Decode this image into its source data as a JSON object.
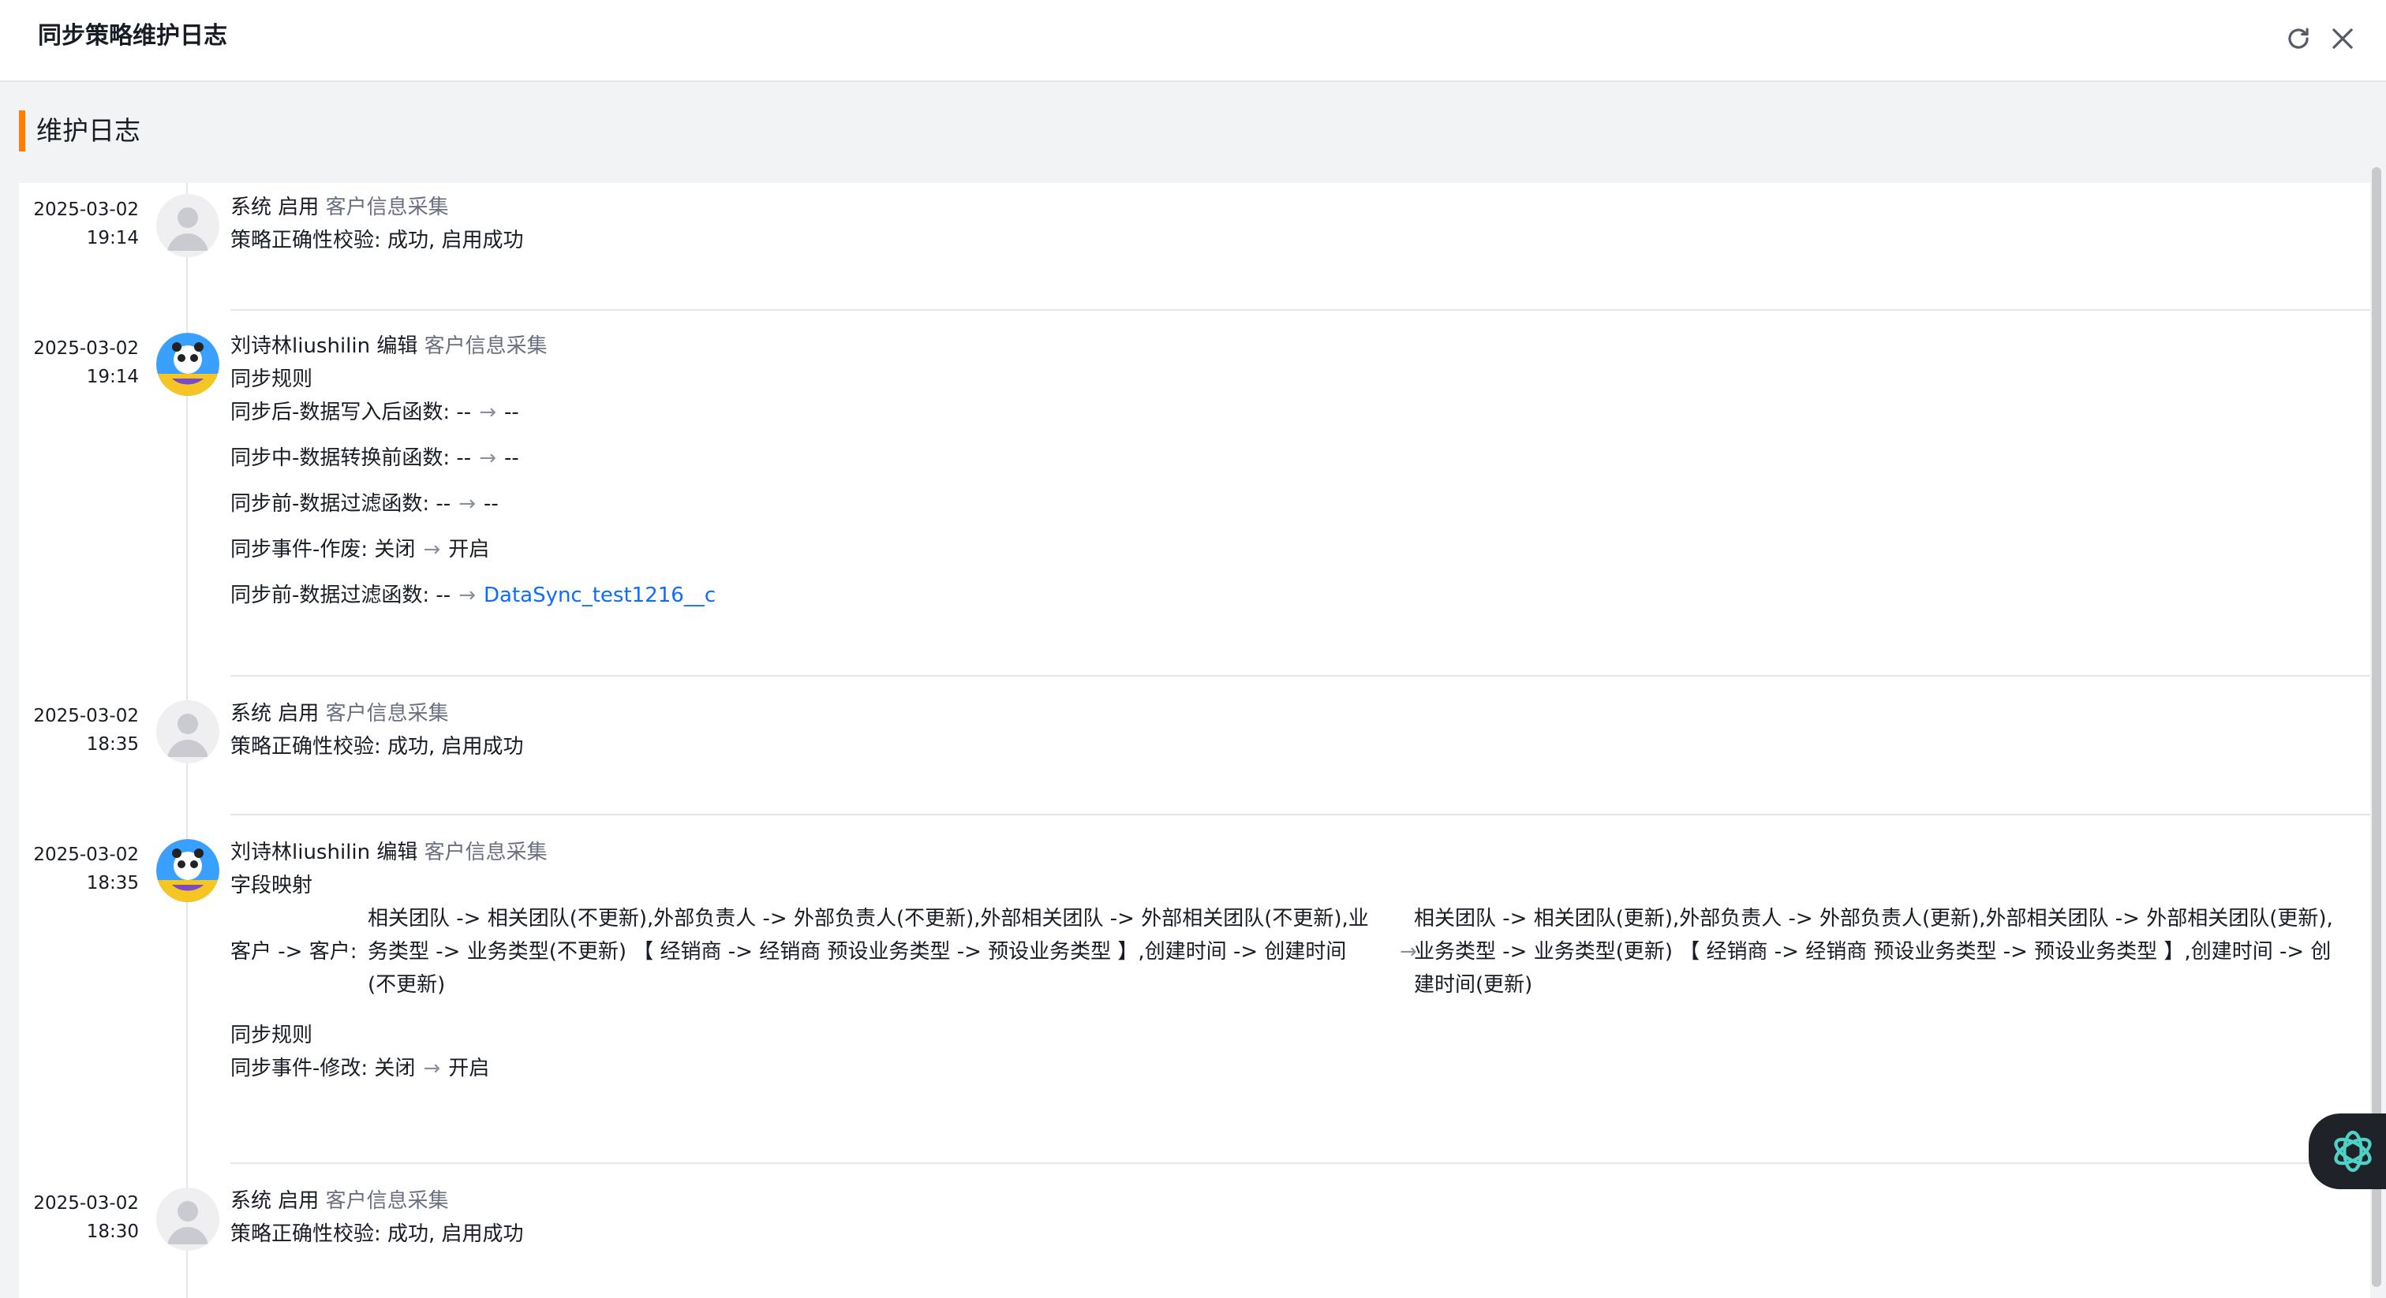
{
  "dialog": {
    "title": "同步策略维护日志",
    "refresh_icon": "refresh-icon",
    "close_icon": "close-icon"
  },
  "section": {
    "title": "维护日志"
  },
  "entries": [
    {
      "date": "2025-03-02",
      "time": "19:14",
      "actor": "系统",
      "action": "启用",
      "target": "客户信息采集",
      "lines": [
        "策略正确性校验: 成功, 启用成功"
      ]
    },
    {
      "date": "2025-03-02",
      "time": "19:14",
      "actor": "刘诗林liushilin",
      "action": "编辑",
      "target": "客户信息采集",
      "heading": "同步规则",
      "changes": [
        {
          "label": "同步后-数据写入后函数:",
          "from": "--",
          "to": "--"
        },
        {
          "label": "同步中-数据转换前函数:",
          "from": "--",
          "to": "--"
        },
        {
          "label": "同步前-数据过滤函数:",
          "from": "--",
          "to": "--"
        },
        {
          "label": "同步事件-作废:",
          "from": "关闭",
          "to": "开启"
        },
        {
          "label": "同步前-数据过滤函数:",
          "from": "--",
          "to": "DataSync_test1216__c"
        }
      ]
    },
    {
      "date": "2025-03-02",
      "time": "18:35",
      "actor": "系统",
      "action": "启用",
      "target": "客户信息采集",
      "lines": [
        "策略正确性校验: 成功, 启用成功"
      ]
    },
    {
      "date": "2025-03-02",
      "time": "18:35",
      "actor": "刘诗林liushilin",
      "action": "编辑",
      "target": "客户信息采集",
      "heading": "字段映射",
      "mapping": {
        "key": "客户 -> 客户:",
        "from": "相关团队 -> 相关团队(不更新),外部负责人 -> 外部负责人(不更新),外部相关团队 -> 外部相关团队(不更新),业务类型 -> 业务类型(不更新) 【 经销商 -> 经销商 预设业务类型 -> 预设业务类型 】,创建时间 -> 创建时间(不更新)",
        "to": "相关团队 -> 相关团队(更新),外部负责人 -> 外部负责人(更新),外部相关团队 -> 外部相关团队(更新),业务类型 -> 业务类型(更新) 【 经销商 -> 经销商 预设业务类型 -> 预设业务类型 】,创建时间 -> 创建时间(更新)"
      },
      "heading2": "同步规则",
      "change2": {
        "label": "同步事件-修改:",
        "from": "关闭",
        "to": "开启"
      }
    },
    {
      "date": "2025-03-02",
      "time": "18:30",
      "actor": "系统",
      "action": "启用",
      "target": "客户信息采集",
      "lines": [
        "策略正确性校验: 成功, 启用成功"
      ]
    }
  ],
  "arrow_glyph": "→",
  "fab": {
    "icon": "openai-logo-icon"
  }
}
